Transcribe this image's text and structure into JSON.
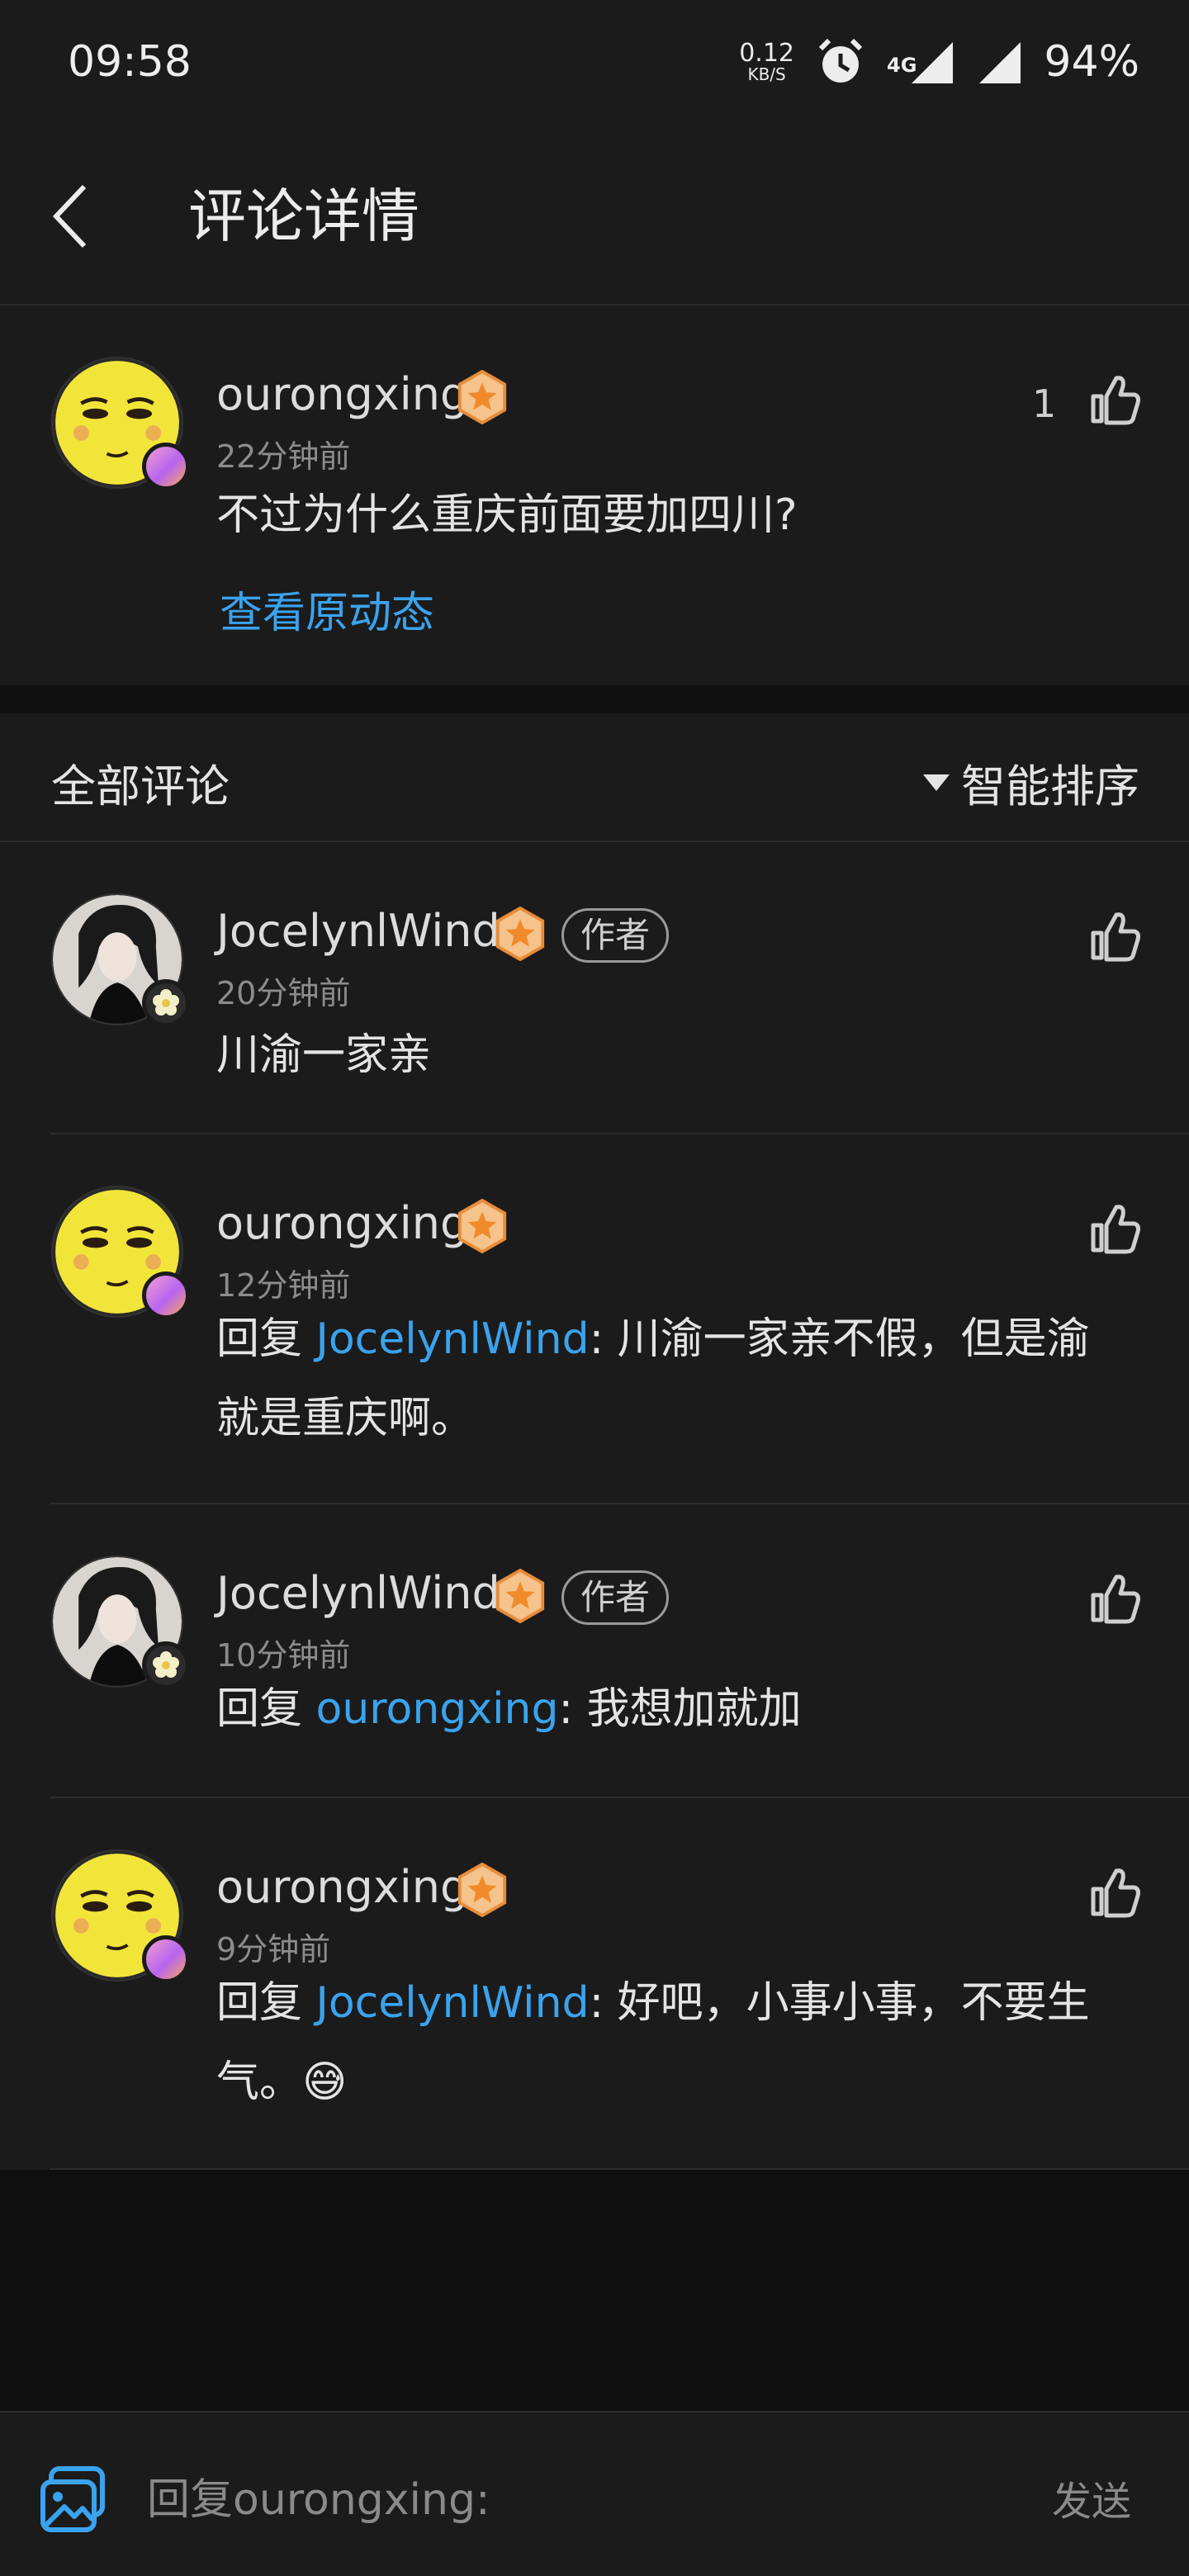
{
  "status_bar": {
    "time": "09:58",
    "net_speed": "0.12",
    "net_unit": "KB/S",
    "network": "4G",
    "battery": "94%"
  },
  "header": {
    "title": "评论详情"
  },
  "original": {
    "username": "ourongxing",
    "time": "22分钟前",
    "text": "不过为什么重庆前面要加四川?",
    "like_count": "1",
    "view_link": "查看原动态"
  },
  "section": {
    "all_label": "全部评论",
    "sort_label": "智能排序"
  },
  "comments": [
    {
      "username": "JocelynlWind",
      "author_tag": "作者",
      "time": "20分钟前",
      "text": "川渝一家亲"
    },
    {
      "username": "ourongxing",
      "time": "12分钟前",
      "reply_prefix": "回复 ",
      "mention": "JocelynlWind",
      "text_line1": ": 川渝一家亲不假，但是渝",
      "text_line2": "就是重庆啊。"
    },
    {
      "username": "JocelynlWind",
      "author_tag": "作者",
      "time": "10分钟前",
      "reply_prefix": "回复 ",
      "mention": "ourongxing",
      "text_line1": ": 我想加就加"
    },
    {
      "username": "ourongxing",
      "time": "9分钟前",
      "reply_prefix": "回复 ",
      "mention": "JocelynlWind",
      "text_line1": ": 好吧，小事小事，不要生",
      "text_line2": "气。😅"
    }
  ],
  "reply_bar": {
    "placeholder": "回复ourongxing:",
    "send_label": "发送"
  },
  "colors": {
    "accent": "#3aa3ee",
    "background": "#1b1b1b",
    "emoji_face": "#f4e838"
  }
}
